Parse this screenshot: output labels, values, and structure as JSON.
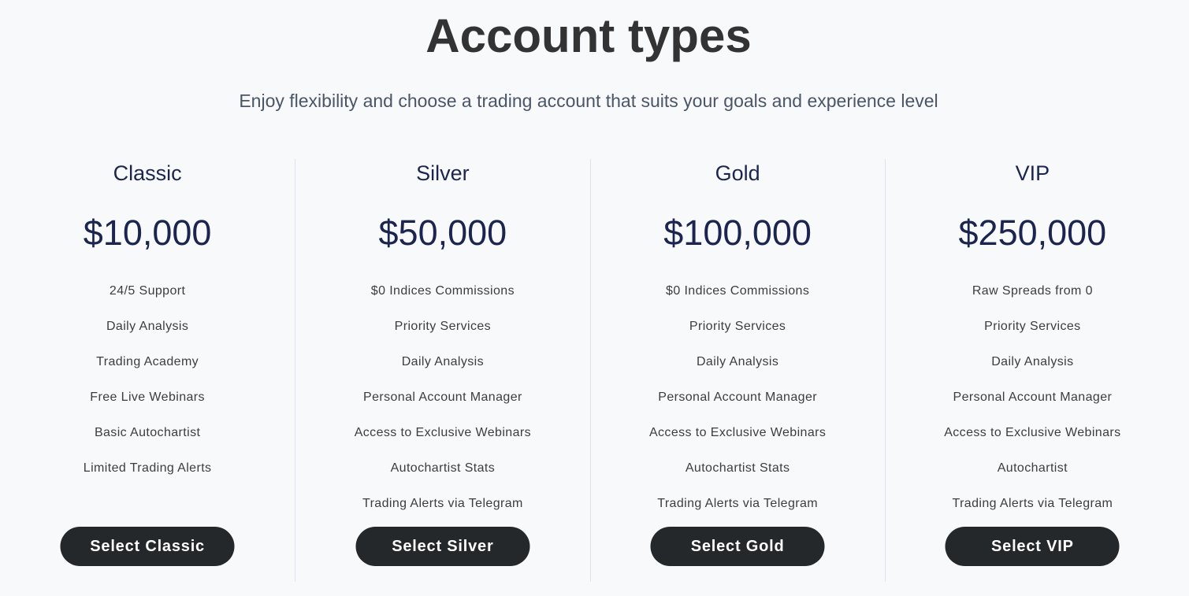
{
  "header": {
    "title": "Account types",
    "subtitle": "Enjoy flexibility and choose a trading account that suits your goals and experience level"
  },
  "plans": [
    {
      "name": "Classic",
      "price": "$10,000",
      "features": [
        "24/5 Support",
        "Daily Analysis",
        "Trading Academy",
        "Free Live Webinars",
        "Basic Autochartist",
        "Limited Trading Alerts"
      ],
      "button_label": "Select Classic"
    },
    {
      "name": "Silver",
      "price": "$50,000",
      "features": [
        "$0 Indices Commissions",
        "Priority Services",
        "Daily Analysis",
        "Personal Account Manager",
        "Access to Exclusive Webinars",
        "Autochartist Stats",
        "Trading Alerts via Telegram"
      ],
      "button_label": "Select Silver"
    },
    {
      "name": "Gold",
      "price": "$100,000",
      "features": [
        "$0 Indices Commissions",
        "Priority Services",
        "Daily Analysis",
        "Personal Account Manager",
        "Access to Exclusive Webinars",
        "Autochartist Stats",
        "Trading Alerts via Telegram"
      ],
      "button_label": "Select Gold"
    },
    {
      "name": "VIP",
      "price": "$250,000",
      "features": [
        "Raw Spreads from 0",
        "Priority Services",
        "Daily Analysis",
        "Personal Account Manager",
        "Access to Exclusive Webinars",
        "Autochartist",
        "Trading Alerts via Telegram"
      ],
      "button_label": "Select VIP"
    }
  ],
  "colors": {
    "background": "#f8f9fb",
    "title": "#333333",
    "subtitle": "#4a5568",
    "plan_heading": "#1c2550",
    "feature_text": "#3d3d3d",
    "button_bg": "#25282b",
    "button_text": "#ffffff",
    "divider": "#dde4ee"
  }
}
